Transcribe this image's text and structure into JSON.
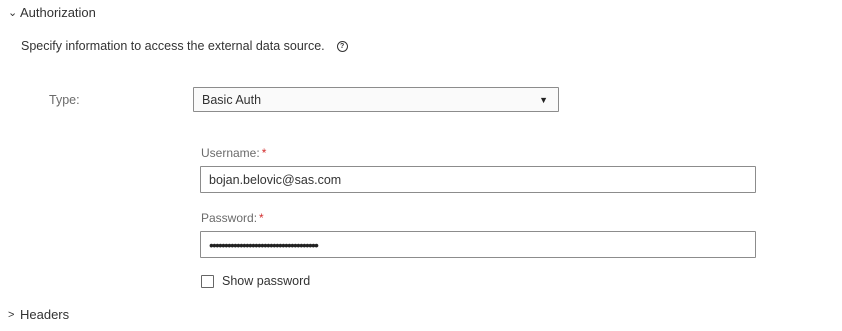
{
  "authorization": {
    "header": "Authorization",
    "chevron": "chevron-down-icon",
    "description": "Specify information to access the external data source.",
    "help_icon": "?",
    "type_label": "Type:",
    "type_value": "Basic Auth",
    "username_label": "Username:",
    "username_required": "*",
    "username_value": "bojan.belovic@sas.com",
    "password_label": "Password:",
    "password_required": "*",
    "password_masked": "••••••••••••••••••••••••••••••••••••",
    "show_password_label": "Show password",
    "show_password_checked": false
  },
  "headers": {
    "header": "Headers",
    "chevron": "chevron-right-icon"
  }
}
